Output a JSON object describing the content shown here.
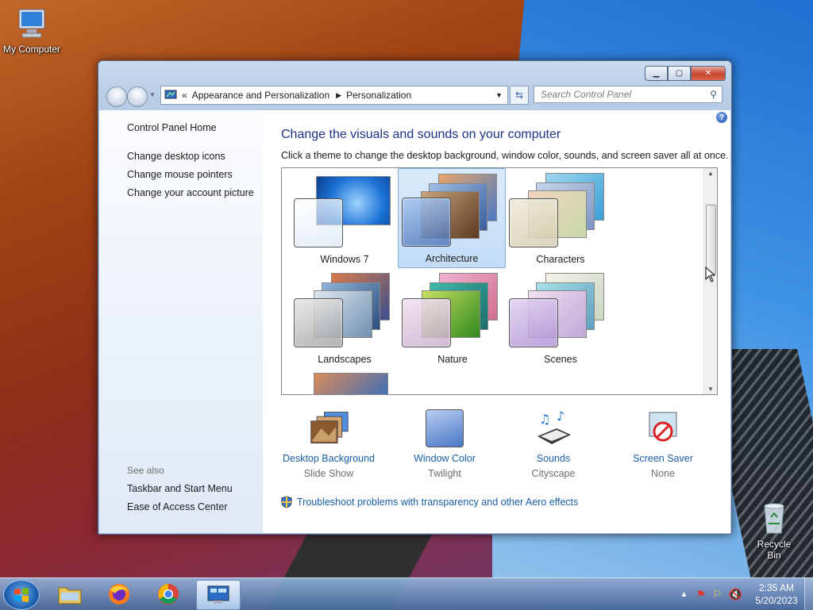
{
  "desktop": {
    "icons": [
      {
        "label": "My Computer"
      },
      {
        "label": "Recycle Bin"
      }
    ]
  },
  "window": {
    "controls": {
      "minimize": "▁",
      "maximize": "▢",
      "close": "✕"
    },
    "address": {
      "crumb1": "Appearance and Personalization",
      "crumb2": "Personalization",
      "prefix": "«"
    },
    "search_placeholder": "Search Control Panel",
    "left_pane": {
      "home": "Control Panel Home",
      "links": [
        "Change desktop icons",
        "Change mouse pointers",
        "Change your account picture"
      ],
      "see_also_title": "See also",
      "see_also": [
        "Taskbar and Start Menu",
        "Ease of Access Center"
      ]
    },
    "heading": "Change the visuals and sounds on your computer",
    "subheading": "Click a theme to change the desktop background, window color, sounds, and screen saver all at once.",
    "themes": [
      {
        "name": "Windows 7",
        "selected": false
      },
      {
        "name": "Architecture",
        "selected": true
      },
      {
        "name": "Characters",
        "selected": false
      },
      {
        "name": "Landscapes",
        "selected": false
      },
      {
        "name": "Nature",
        "selected": false
      },
      {
        "name": "Scenes",
        "selected": false
      }
    ],
    "bottom": [
      {
        "title": "Desktop Background",
        "value": "Slide Show"
      },
      {
        "title": "Window Color",
        "value": "Twilight"
      },
      {
        "title": "Sounds",
        "value": "Cityscape"
      },
      {
        "title": "Screen Saver",
        "value": "None"
      }
    ],
    "troubleshoot": "Troubleshoot problems with transparency and other Aero effects"
  },
  "taskbar": {
    "time": "2:35 AM",
    "date": "5/20/2023"
  }
}
